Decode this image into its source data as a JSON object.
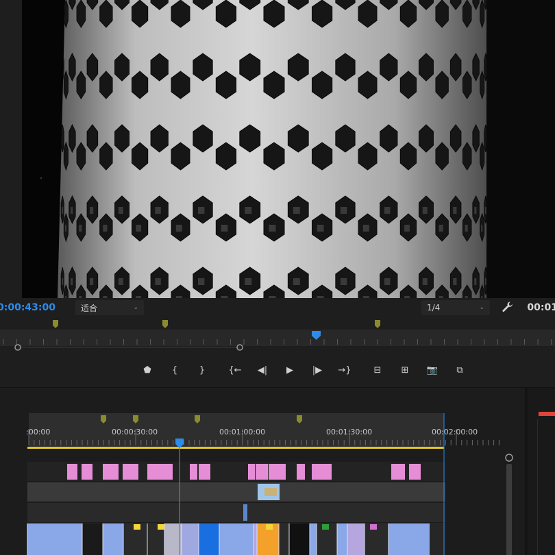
{
  "monitor": {
    "timecode_current": "0:00:43:00",
    "zoom_value": "适合",
    "resolution_value": "1/4",
    "timecode_duration": "00:01",
    "settings_icon": "wrench-icon"
  },
  "transport": {
    "buttons": [
      {
        "name": "add-marker-button",
        "glyph": "⬟"
      },
      {
        "name": "mark-in-button",
        "glyph": "{"
      },
      {
        "name": "mark-out-button",
        "glyph": "}"
      },
      {
        "name": "go-to-in-button",
        "glyph": "{←"
      },
      {
        "name": "step-back-button",
        "glyph": "◀|"
      },
      {
        "name": "play-button",
        "glyph": "▶"
      },
      {
        "name": "step-forward-button",
        "glyph": "|▶"
      },
      {
        "name": "go-to-out-button",
        "glyph": "→}"
      },
      {
        "name": "lift-button",
        "glyph": "⊟"
      },
      {
        "name": "extract-button",
        "glyph": "⊞"
      },
      {
        "name": "export-frame-button",
        "glyph": "📷"
      },
      {
        "name": "compare-view-button",
        "glyph": "⧉"
      }
    ]
  },
  "timeline": {
    "ruler_labels": [
      {
        "name": "ruler-label-0",
        "text": ":00:00"
      },
      {
        "name": "ruler-label-30s",
        "text": "00:00:30:00"
      },
      {
        "name": "ruler-label-1m",
        "text": "00:01:00:00"
      },
      {
        "name": "ruler-label-1m30s",
        "text": "00:01:30:00"
      },
      {
        "name": "ruler-label-2m",
        "text": "00:02:00:00"
      }
    ],
    "colors": {
      "playhead": "#2d8ceb",
      "work_area": "#e3c627",
      "audio_clip": "#e58ed6",
      "video_clip": "#8aa7e8",
      "marker": "#8a8b2e"
    }
  }
}
